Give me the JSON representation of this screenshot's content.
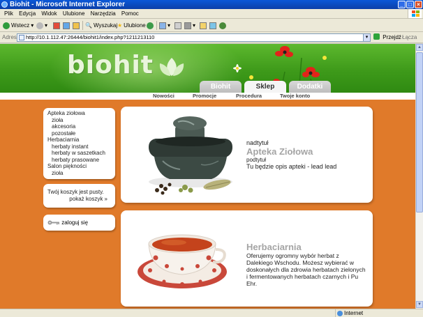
{
  "window": {
    "title": "Biohit - Microsoft Internet Explorer",
    "controls": [
      "_",
      "□",
      "×"
    ]
  },
  "menu": [
    "Plik",
    "Edycja",
    "Widok",
    "Ulubione",
    "Narzędzia",
    "Pomoc"
  ],
  "toolbar": {
    "back_label": "Wstecz",
    "search_label": "Wyszukaj",
    "favorites_label": "Ulubione"
  },
  "address": {
    "label": "Adres",
    "url": "http://10.1.112.47:26444/biohit1/index.php?1211213110",
    "go_label": "Przejdź",
    "links_label": "Łącza"
  },
  "status": {
    "zone_label": "Internet"
  },
  "site": {
    "logo": "biohit",
    "tabs": [
      "Biohit",
      "Sklep",
      "Dodatki"
    ],
    "active_tab": "Sklep",
    "subnav": [
      "Nowości",
      "Promocje",
      "Procedura",
      "Twoje konto"
    ],
    "colors": {
      "background": "#e07a2a",
      "header_green": "#3e9a1a",
      "title_gray": "#a4a4a4"
    }
  },
  "sidebar": {
    "categories": [
      {
        "label": "Apteka ziołowa",
        "level": 0
      },
      {
        "label": "zioła",
        "level": 1
      },
      {
        "label": "akcesoria",
        "level": 1
      },
      {
        "label": "pozostałe",
        "level": 1
      },
      {
        "label": "Herbaciarnia",
        "level": 0
      },
      {
        "label": "herbaty instant",
        "level": 1
      },
      {
        "label": "herbaty w saszetkach",
        "level": 1
      },
      {
        "label": "herbaty prasowane",
        "level": 1
      },
      {
        "label": "Salon piękności",
        "level": 0
      },
      {
        "label": "zioła",
        "level": 1
      }
    ],
    "cart": {
      "empty_text": "Twój koszyk jest pusty.",
      "show_link": "pokaż koszyk »"
    },
    "login": {
      "label": "zaloguj się",
      "icon": "key-icon"
    }
  },
  "panels": [
    {
      "overtitle": "nadtytuł",
      "title": "Apteka Ziołowa",
      "subtitle": "podtytuł",
      "text": "Tu będzie opis apteki - lead lead",
      "image": "mortar-and-pestle-with-herbs"
    },
    {
      "title": "Herbaciarnia",
      "text": "Oferujemy ogromny wybór herbat z Dalekiego Wschodu. Możesz wybierać w doskonałych dla zdrowia herbatach zielonych i fermentowanych herbatach czarnych i Pu Ehr.",
      "image": "cup-of-tea-on-saucer"
    }
  ]
}
